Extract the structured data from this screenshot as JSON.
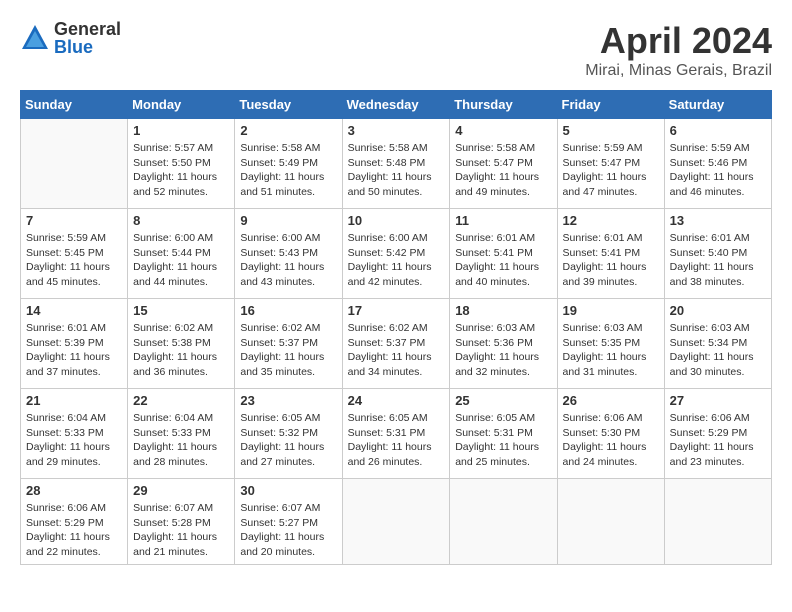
{
  "header": {
    "logo_general": "General",
    "logo_blue": "Blue",
    "month_title": "April 2024",
    "location": "Mirai, Minas Gerais, Brazil"
  },
  "calendar": {
    "days_of_week": [
      "Sunday",
      "Monday",
      "Tuesday",
      "Wednesday",
      "Thursday",
      "Friday",
      "Saturday"
    ],
    "weeks": [
      [
        {
          "day": "",
          "info": ""
        },
        {
          "day": "1",
          "info": "Sunrise: 5:57 AM\nSunset: 5:50 PM\nDaylight: 11 hours\nand 52 minutes."
        },
        {
          "day": "2",
          "info": "Sunrise: 5:58 AM\nSunset: 5:49 PM\nDaylight: 11 hours\nand 51 minutes."
        },
        {
          "day": "3",
          "info": "Sunrise: 5:58 AM\nSunset: 5:48 PM\nDaylight: 11 hours\nand 50 minutes."
        },
        {
          "day": "4",
          "info": "Sunrise: 5:58 AM\nSunset: 5:47 PM\nDaylight: 11 hours\nand 49 minutes."
        },
        {
          "day": "5",
          "info": "Sunrise: 5:59 AM\nSunset: 5:47 PM\nDaylight: 11 hours\nand 47 minutes."
        },
        {
          "day": "6",
          "info": "Sunrise: 5:59 AM\nSunset: 5:46 PM\nDaylight: 11 hours\nand 46 minutes."
        }
      ],
      [
        {
          "day": "7",
          "info": "Sunrise: 5:59 AM\nSunset: 5:45 PM\nDaylight: 11 hours\nand 45 minutes."
        },
        {
          "day": "8",
          "info": "Sunrise: 6:00 AM\nSunset: 5:44 PM\nDaylight: 11 hours\nand 44 minutes."
        },
        {
          "day": "9",
          "info": "Sunrise: 6:00 AM\nSunset: 5:43 PM\nDaylight: 11 hours\nand 43 minutes."
        },
        {
          "day": "10",
          "info": "Sunrise: 6:00 AM\nSunset: 5:42 PM\nDaylight: 11 hours\nand 42 minutes."
        },
        {
          "day": "11",
          "info": "Sunrise: 6:01 AM\nSunset: 5:41 PM\nDaylight: 11 hours\nand 40 minutes."
        },
        {
          "day": "12",
          "info": "Sunrise: 6:01 AM\nSunset: 5:41 PM\nDaylight: 11 hours\nand 39 minutes."
        },
        {
          "day": "13",
          "info": "Sunrise: 6:01 AM\nSunset: 5:40 PM\nDaylight: 11 hours\nand 38 minutes."
        }
      ],
      [
        {
          "day": "14",
          "info": "Sunrise: 6:01 AM\nSunset: 5:39 PM\nDaylight: 11 hours\nand 37 minutes."
        },
        {
          "day": "15",
          "info": "Sunrise: 6:02 AM\nSunset: 5:38 PM\nDaylight: 11 hours\nand 36 minutes."
        },
        {
          "day": "16",
          "info": "Sunrise: 6:02 AM\nSunset: 5:37 PM\nDaylight: 11 hours\nand 35 minutes."
        },
        {
          "day": "17",
          "info": "Sunrise: 6:02 AM\nSunset: 5:37 PM\nDaylight: 11 hours\nand 34 minutes."
        },
        {
          "day": "18",
          "info": "Sunrise: 6:03 AM\nSunset: 5:36 PM\nDaylight: 11 hours\nand 32 minutes."
        },
        {
          "day": "19",
          "info": "Sunrise: 6:03 AM\nSunset: 5:35 PM\nDaylight: 11 hours\nand 31 minutes."
        },
        {
          "day": "20",
          "info": "Sunrise: 6:03 AM\nSunset: 5:34 PM\nDaylight: 11 hours\nand 30 minutes."
        }
      ],
      [
        {
          "day": "21",
          "info": "Sunrise: 6:04 AM\nSunset: 5:33 PM\nDaylight: 11 hours\nand 29 minutes."
        },
        {
          "day": "22",
          "info": "Sunrise: 6:04 AM\nSunset: 5:33 PM\nDaylight: 11 hours\nand 28 minutes."
        },
        {
          "day": "23",
          "info": "Sunrise: 6:05 AM\nSunset: 5:32 PM\nDaylight: 11 hours\nand 27 minutes."
        },
        {
          "day": "24",
          "info": "Sunrise: 6:05 AM\nSunset: 5:31 PM\nDaylight: 11 hours\nand 26 minutes."
        },
        {
          "day": "25",
          "info": "Sunrise: 6:05 AM\nSunset: 5:31 PM\nDaylight: 11 hours\nand 25 minutes."
        },
        {
          "day": "26",
          "info": "Sunrise: 6:06 AM\nSunset: 5:30 PM\nDaylight: 11 hours\nand 24 minutes."
        },
        {
          "day": "27",
          "info": "Sunrise: 6:06 AM\nSunset: 5:29 PM\nDaylight: 11 hours\nand 23 minutes."
        }
      ],
      [
        {
          "day": "28",
          "info": "Sunrise: 6:06 AM\nSunset: 5:29 PM\nDaylight: 11 hours\nand 22 minutes."
        },
        {
          "day": "29",
          "info": "Sunrise: 6:07 AM\nSunset: 5:28 PM\nDaylight: 11 hours\nand 21 minutes."
        },
        {
          "day": "30",
          "info": "Sunrise: 6:07 AM\nSunset: 5:27 PM\nDaylight: 11 hours\nand 20 minutes."
        },
        {
          "day": "",
          "info": ""
        },
        {
          "day": "",
          "info": ""
        },
        {
          "day": "",
          "info": ""
        },
        {
          "day": "",
          "info": ""
        }
      ]
    ]
  }
}
